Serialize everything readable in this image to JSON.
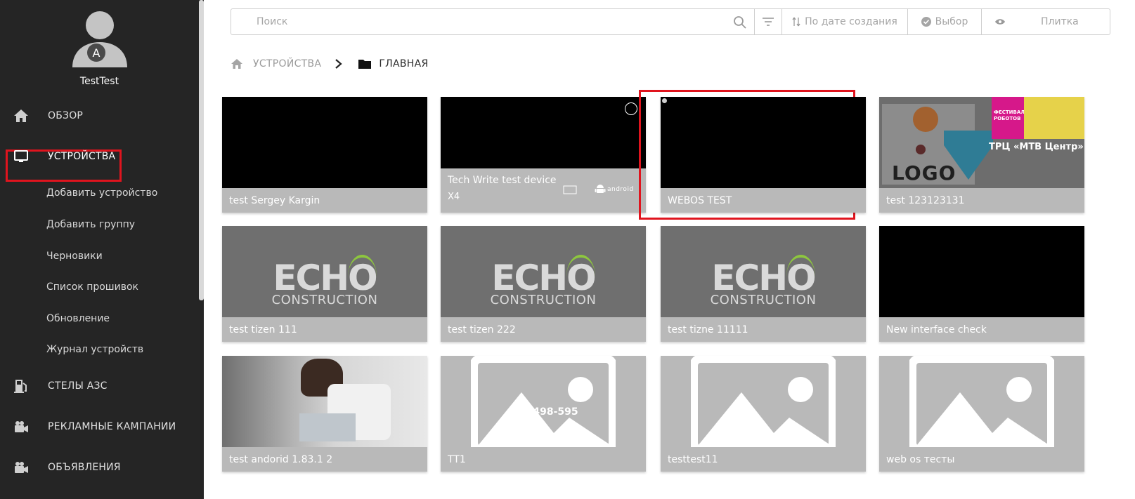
{
  "user": {
    "avatar_letter": "A",
    "name": "TestTest"
  },
  "nav": {
    "overview": "ОБЗОР",
    "devices": "УСТРОЙСТВА",
    "sub_items": [
      "Добавить устройство",
      "Добавить группу",
      "Черновики",
      "Список прошивок",
      "Обновление",
      "Журнал устройств"
    ],
    "gas_stations": "СТЕЛЫ АЗС",
    "ad_campaigns": "РЕКЛАМНЫЕ КАМПАНИИ",
    "announcements": "ОБЪЯВЛЕНИЯ"
  },
  "toolbar": {
    "search_placeholder": "Поиск",
    "sort_label": "По дате создания",
    "select_label": "Выбор",
    "view_label": "Плитка"
  },
  "breadcrumb": {
    "root": "УСТРОЙСТВА",
    "current": "ГЛАВНАЯ"
  },
  "devices": [
    {
      "title": "test Sergey Kargin",
      "preview": "black"
    },
    {
      "title": "Tech Write test device",
      "subtitle": "X4",
      "os_label": "android",
      "preview": "black",
      "selected": true
    },
    {
      "title": "WEBOS TEST",
      "preview": "black"
    },
    {
      "title": "test 123123131",
      "preview": "promo",
      "promo_text": [
        "LOGO",
        "ФЕСТИВАЛЬ РОБОТОВ",
        "ТРЦ «МТВ Центр»"
      ]
    },
    {
      "title": "test tizen 111",
      "preview": "echo"
    },
    {
      "title": "test tizen 222",
      "preview": "echo"
    },
    {
      "title": "test tizne 11111",
      "preview": "echo"
    },
    {
      "title": "New interface check",
      "preview": "black"
    },
    {
      "title": "test andorid 1.83.1 2",
      "preview": "photo"
    },
    {
      "title": "TT1",
      "preview": "placeholder",
      "overlay_text": "644-498-595"
    },
    {
      "title": "testtest11",
      "preview": "placeholder"
    },
    {
      "title": "web os тесты",
      "preview": "placeholder"
    }
  ],
  "echo_logo": {
    "main": "ECHO",
    "sub": "CONSTRUCTION"
  },
  "colors": {
    "sidebar_bg": "#252525",
    "highlight": "#e0141e",
    "card_caption": "#b9b9b9",
    "echo_green": "#8dc63f"
  }
}
